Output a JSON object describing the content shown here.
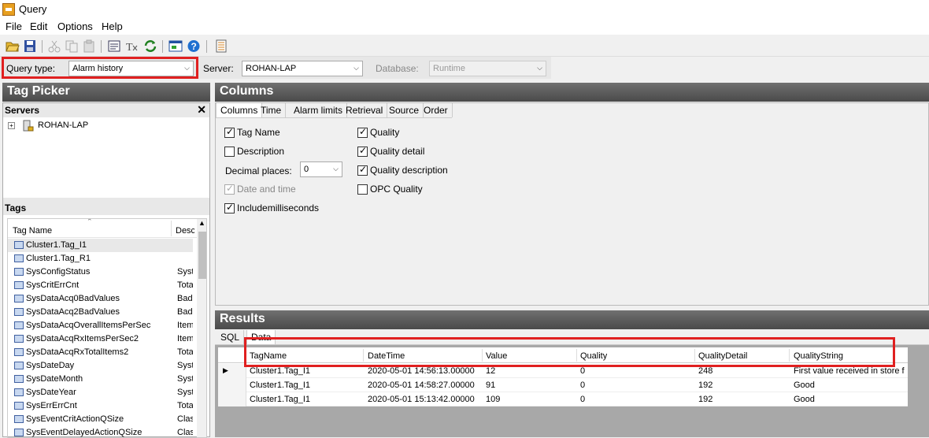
{
  "window": {
    "title": "Query"
  },
  "menu": [
    "File",
    "Edit",
    "Options",
    "Help"
  ],
  "query_bar": {
    "query_type_label": "Query type:",
    "query_type_value": "Alarm history",
    "server_label": "Server:",
    "server_value": "ROHAN-LAP",
    "database_label": "Database:",
    "database_value": "Runtime"
  },
  "tag_picker": {
    "title": "Tag Picker",
    "servers_label": "Servers",
    "server_node": "ROHAN-LAP",
    "tags_label": "Tags",
    "columns": [
      "Tag Name",
      "Desc"
    ],
    "rows": [
      {
        "name": "Cluster1.Tag_I1",
        "desc": ""
      },
      {
        "name": "Cluster1.Tag_R1",
        "desc": ""
      },
      {
        "name": "SysConfigStatus",
        "desc": "Syst"
      },
      {
        "name": "SysCritErrCnt",
        "desc": "Tota"
      },
      {
        "name": "SysDataAcq0BadValues",
        "desc": "Bad"
      },
      {
        "name": "SysDataAcq2BadValues",
        "desc": "Bad"
      },
      {
        "name": "SysDataAcqOverallItemsPerSec",
        "desc": "Item"
      },
      {
        "name": "SysDataAcqRxItemsPerSec2",
        "desc": "Item"
      },
      {
        "name": "SysDataAcqRxTotalItems2",
        "desc": "Tota"
      },
      {
        "name": "SysDateDay",
        "desc": "Syst"
      },
      {
        "name": "SysDateMonth",
        "desc": "Syst"
      },
      {
        "name": "SysDateYear",
        "desc": "Syst"
      },
      {
        "name": "SysErrErrCnt",
        "desc": "Tota"
      },
      {
        "name": "SysEventCritActionQSize",
        "desc": "Clas"
      },
      {
        "name": "SysEventDelayedActionQSize",
        "desc": "Clas"
      }
    ]
  },
  "columns_panel": {
    "title": "Columns",
    "tabs": [
      "Columns",
      "Time",
      "Alarm limits",
      "Retrieval",
      "Source",
      "Order"
    ],
    "left_options": [
      {
        "label": "Tag Name",
        "checked": true,
        "disabled": false
      },
      {
        "label": "Description",
        "checked": false,
        "disabled": false
      },
      {
        "label": "Date and time",
        "checked": true,
        "disabled": true
      },
      {
        "label": "Includemilliseconds",
        "checked": true,
        "disabled": false
      }
    ],
    "decimal_label": "Decimal places:",
    "decimal_value": "0",
    "right_options": [
      {
        "label": "Quality",
        "checked": true
      },
      {
        "label": "Quality detail",
        "checked": true
      },
      {
        "label": "Quality description",
        "checked": true
      },
      {
        "label": "OPC Quality",
        "checked": false
      }
    ]
  },
  "results_panel": {
    "title": "Results",
    "tabs": [
      "SQL",
      "Data"
    ],
    "columns": [
      "TagName",
      "DateTime",
      "Value",
      "Quality",
      "QualityDetail",
      "QualityString"
    ],
    "rows": [
      [
        "Cluster1.Tag_I1",
        "2020-05-01 14:56:13.00000",
        "12",
        "0",
        "248",
        "First value received in store f"
      ],
      [
        "Cluster1.Tag_I1",
        "2020-05-01 14:58:27.00000",
        "91",
        "0",
        "192",
        "Good"
      ],
      [
        "Cluster1.Tag_I1",
        "2020-05-01 15:13:42.00000",
        "109",
        "0",
        "192",
        "Good"
      ]
    ]
  },
  "colors": {
    "highlight_red": "#e02020",
    "panel_header": "#555555"
  }
}
